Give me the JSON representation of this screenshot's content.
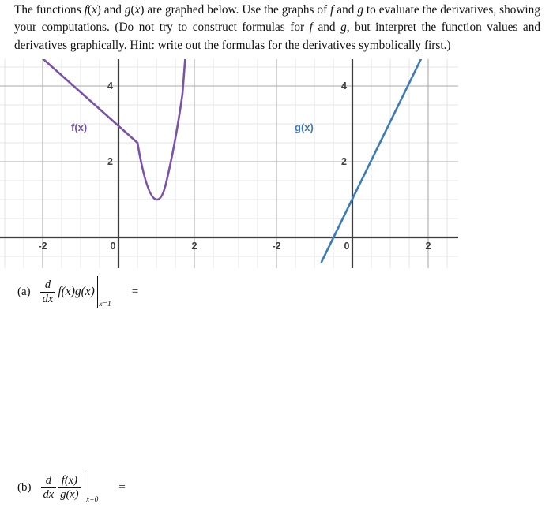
{
  "problem": {
    "text_runs": [
      {
        "t": "The functions ",
        "i": false
      },
      {
        "t": "f",
        "i": true
      },
      {
        "t": "(",
        "i": false
      },
      {
        "t": "x",
        "i": true
      },
      {
        "t": ") and ",
        "i": false
      },
      {
        "t": "g",
        "i": true
      },
      {
        "t": "(",
        "i": false
      },
      {
        "t": "x",
        "i": true
      },
      {
        "t": ") are graphed below.  Use the graphs of ",
        "i": false
      },
      {
        "t": "f",
        "i": true
      },
      {
        "t": " and ",
        "i": false
      },
      {
        "t": "g",
        "i": true
      },
      {
        "t": " to evaluate the derivatives, showing your computations.  (Do not try to construct formulas for ",
        "i": false
      },
      {
        "t": "f",
        "i": true
      },
      {
        "t": " and ",
        "i": false
      },
      {
        "t": "g",
        "i": true
      },
      {
        "t": ", but interpret the function values and derivatives graphically.  Hint: write out the formulas for the derivatives symbolically first.)",
        "i": false
      }
    ],
    "plain": "The functions f(x) and g(x) are graphed below. Use the graphs of f and g to evaluate the derivatives, showing your computations. (Do not try to construct formulas for f and g, but interpret the function values and derivatives graphically. Hint: write out the formulas for the derivatives symbolically first.)"
  },
  "chart_data": [
    {
      "type": "line",
      "name": "f-graph",
      "title": "",
      "curve_label": "f(x)",
      "color": "#7a52a8",
      "xlabel": "",
      "ylabel": "",
      "xlim": [
        -2.85,
        2.6
      ],
      "ylim": [
        -0.45,
        5.2
      ],
      "xticks": [
        -2,
        0,
        2
      ],
      "xtick_labels": [
        "-2",
        "0",
        "2"
      ],
      "yticks": [
        2,
        4
      ],
      "ytick_labels": [
        "2",
        "4"
      ],
      "grid": true,
      "grid_minor_step": 0.5,
      "grid_major_step": 2,
      "description": "Piecewise: a straight line of slope -1 passing through (0,3) for x <= 0.5, joined at a corner to an upward parabola with vertex near (1,1).",
      "segments": [
        {
          "kind": "linear",
          "slope": -1,
          "intercept": 3,
          "x_range": [
            -2.85,
            0.5
          ],
          "points": [
            [
              -2.85,
              5.85
            ],
            [
              0.5,
              2.5
            ]
          ]
        },
        {
          "kind": "parabola",
          "vertex": [
            1.0,
            1.0
          ],
          "a": 11.5,
          "x_range": [
            0.5,
            1.78
          ],
          "points": [
            [
              0.5,
              3.875
            ],
            [
              0.75,
              1.72
            ],
            [
              1.0,
              1.0
            ],
            [
              1.25,
              1.72
            ],
            [
              1.5,
              3.875
            ],
            [
              1.78,
              7.2
            ]
          ]
        }
      ],
      "key_points": [
        {
          "label": "y-intercept",
          "x": 0,
          "y": 3
        },
        {
          "label": "corner",
          "x": 0.5,
          "y": 2.5
        },
        {
          "label": "minimum",
          "x": 1,
          "y": 1
        }
      ]
    },
    {
      "type": "line",
      "name": "g-graph",
      "title": "",
      "curve_label": "g(x)",
      "color": "#3b7cb8",
      "xlabel": "",
      "ylabel": "",
      "xlim": [
        -2.85,
        2.6
      ],
      "ylim": [
        -0.45,
        5.2
      ],
      "xticks": [
        -2,
        0,
        2
      ],
      "xtick_labels": [
        "-2",
        "0",
        "2"
      ],
      "yticks": [
        2,
        4
      ],
      "ytick_labels": [
        "2",
        "4"
      ],
      "grid": true,
      "grid_minor_step": 0.5,
      "grid_major_step": 2,
      "description": "A straight line with slope 2 and y-intercept 1; crosses the x-axis at x = -0.5.",
      "segments": [
        {
          "kind": "linear",
          "slope": 2,
          "intercept": 1,
          "x_range": [
            -0.82,
            2.12
          ],
          "points": [
            [
              -0.82,
              -0.64
            ],
            [
              0,
              1
            ],
            [
              2.12,
              5.24
            ]
          ]
        }
      ],
      "key_points": [
        {
          "label": "y-intercept",
          "x": 0,
          "y": 1
        },
        {
          "label": "x-intercept",
          "x": -0.5,
          "y": 0
        }
      ]
    }
  ],
  "parts": {
    "a": {
      "tag": "(a)",
      "d": "d",
      "dx": "dx",
      "expr": "f(x)g(x)",
      "eval_at": "x=1",
      "equals": "="
    },
    "b": {
      "tag": "(b)",
      "d": "d",
      "dx": "dx",
      "num": "f(x)",
      "den": "g(x)",
      "eval_at": "x=0",
      "equals": "="
    }
  },
  "colors": {
    "f_curve": "#7a52a8",
    "g_curve": "#3b7cb8",
    "axis": "#3d3d3d",
    "grid_minor": "#e2e2e2",
    "grid_major": "#a8a8a8",
    "text": "#111111"
  }
}
